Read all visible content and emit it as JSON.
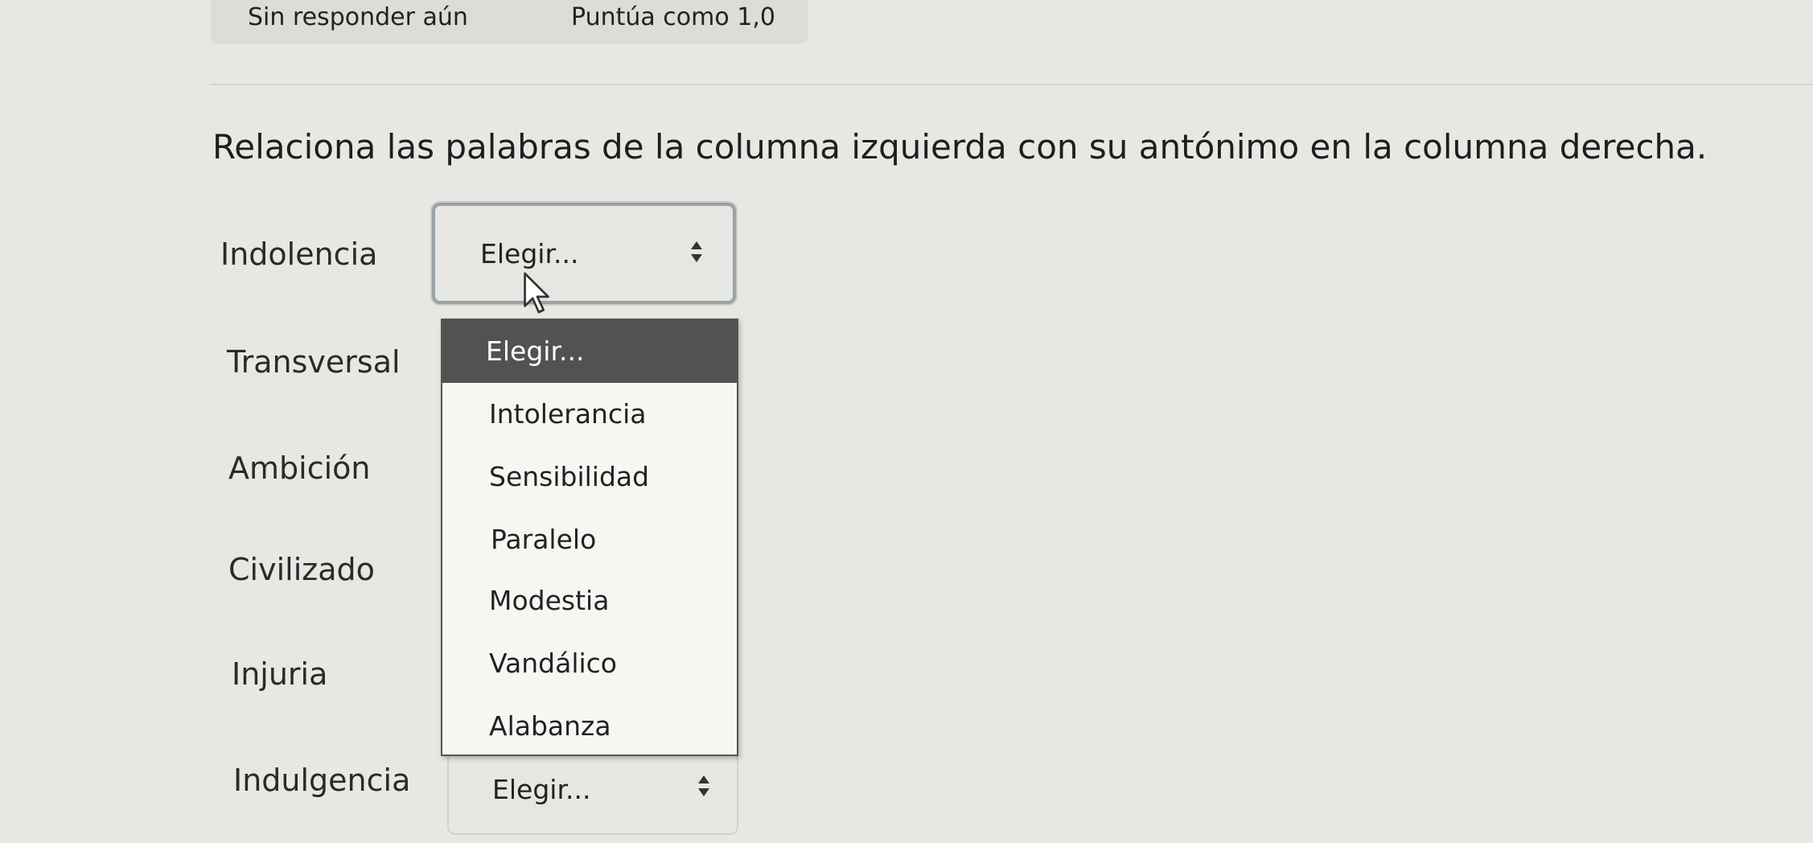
{
  "info": {
    "state": "Sin responder aún",
    "score": "Puntúa como 1,0"
  },
  "question": {
    "prompt": "Relaciona las palabras de la columna izquierda con su antónimo en la columna derecha."
  },
  "rows": [
    {
      "label": "Indolencia",
      "select_value": "Elegir..."
    },
    {
      "label": "Transversal"
    },
    {
      "label": "Ambición"
    },
    {
      "label": "Civilizado"
    },
    {
      "label": "Injuria"
    },
    {
      "label": "Indulgencia",
      "select_value": "Elegir..."
    }
  ],
  "dropdown": {
    "options": [
      "Elegir...",
      "Intolerancia",
      "Sensibilidad",
      "Paralelo",
      "Modestia",
      "Vandálico",
      "Alabanza"
    ],
    "selected": "Elegir..."
  },
  "icons": {
    "select_arrows": "updown-arrows-icon",
    "cursor": "mouse-pointer-icon"
  },
  "colors": {
    "page_background": "#e7e8e3",
    "selected_option_background": "#515352",
    "selected_option_text": "#ffffff"
  }
}
